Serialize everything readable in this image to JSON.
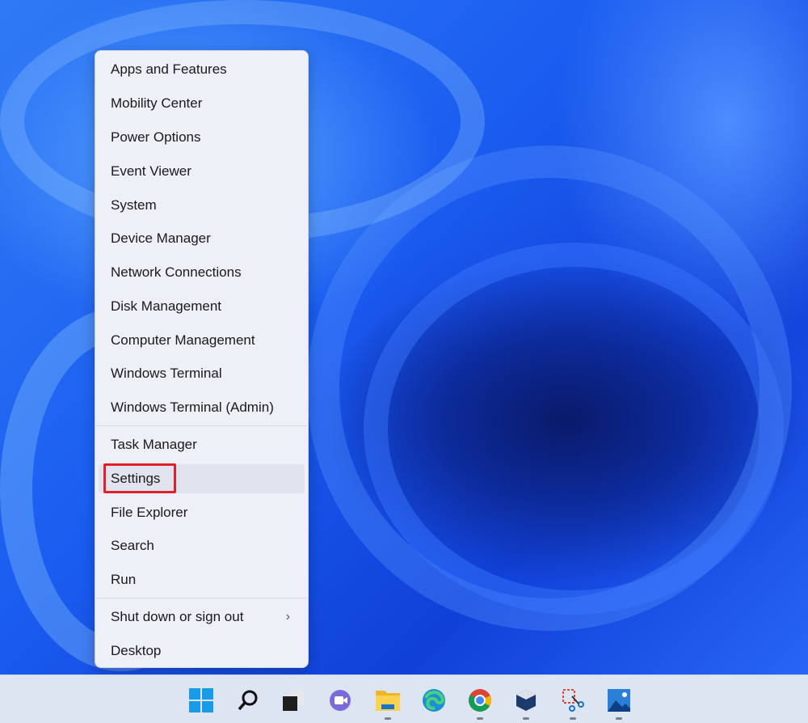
{
  "context_menu": {
    "items": [
      "Apps and Features",
      "Mobility Center",
      "Power Options",
      "Event Viewer",
      "System",
      "Device Manager",
      "Network Connections",
      "Disk Management",
      "Computer Management",
      "Windows Terminal",
      "Windows Terminal (Admin)"
    ],
    "items2": [
      "Task Manager",
      "Settings",
      "File Explorer",
      "Search",
      "Run"
    ],
    "items3": [
      "Shut down or sign out",
      "Desktop"
    ],
    "highlighted": "Settings",
    "submenu_chevron": "›"
  },
  "taskbar": {
    "icons": [
      "windows-start",
      "search",
      "task-view",
      "teams-chat",
      "file-explorer",
      "edge",
      "chrome",
      "virtualbox",
      "snipping-tool",
      "photos"
    ]
  },
  "colors": {
    "highlight_box": "#e0202a",
    "accent": "#0078d4"
  }
}
